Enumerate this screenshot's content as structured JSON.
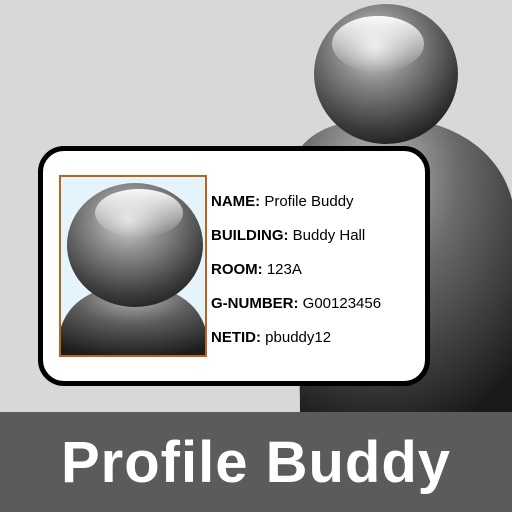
{
  "card": {
    "fields": [
      {
        "label": "NAME:",
        "value": "Profile Buddy"
      },
      {
        "label": "BUILDING:",
        "value": "Buddy Hall"
      },
      {
        "label": "ROOM:",
        "value": "123A"
      },
      {
        "label": "G-NUMBER:",
        "value": "G00123456"
      },
      {
        "label": "NETID:",
        "value": "pbuddy12"
      }
    ]
  },
  "banner": {
    "title": "Profile Buddy"
  },
  "colors": {
    "background": "#d8d8d8",
    "banner": "#5b5b5b",
    "photo_border": "#b5651d",
    "photo_background": "#e4f4fa"
  },
  "icons": {
    "background_figure": "person-silhouette-icon",
    "photo_figure": "person-avatar-icon"
  }
}
